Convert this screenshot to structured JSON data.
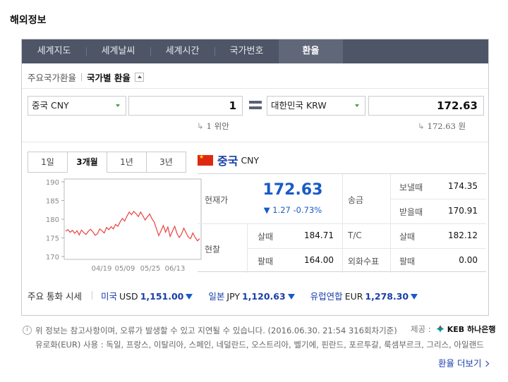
{
  "section_title": "해외정보",
  "tabs": [
    {
      "label": "세계지도"
    },
    {
      "label": "세계날씨"
    },
    {
      "label": "세계시간"
    },
    {
      "label": "국가번호"
    },
    {
      "label": "환율"
    }
  ],
  "subnav": {
    "item": "주요국가환율",
    "current": "국가별 환율"
  },
  "converter": {
    "from_currency": "중국 CNY",
    "from_amount": "1",
    "from_hint": "1 위안",
    "to_currency": "대한민국 KRW",
    "to_amount": "172.63",
    "to_hint": "172.63 원",
    "hint_arrow": "↳"
  },
  "period_tabs": [
    "1일",
    "3개월",
    "1년",
    "3년"
  ],
  "currency": {
    "name": "중국",
    "code": "CNY"
  },
  "rates": {
    "current_label": "현재가",
    "current_value": "172.63",
    "change": "▼ 1.27 -0.73%",
    "cash_label": "현찰",
    "buy_label": "살때",
    "buy_value": "184.71",
    "sell_label": "팔때",
    "sell_value": "164.00",
    "remit_label": "송금",
    "send_label": "보낼때",
    "send_value": "174.35",
    "receive_label": "받을때",
    "receive_value": "170.91",
    "tc_label": "T/C",
    "tc_buy_label": "살때",
    "tc_buy_value": "182.12",
    "check_label": "외화수표",
    "check_sell_label": "팔때",
    "check_sell_value": "0.00"
  },
  "major": {
    "title": "주요 통화 시세",
    "items": [
      {
        "name": "미국",
        "code": "USD",
        "value": "1,151.00"
      },
      {
        "name": "일본",
        "code": "JPY",
        "value": "1,120.63"
      },
      {
        "name": "유럽연합",
        "code": "EUR",
        "value": "1,278.30"
      }
    ]
  },
  "note": {
    "line1": "위 정보는 참고사항이며, 오류가 발생할 수 있고 지연될 수 있습니다. (2016.06.30. 21:54 316회차기준)",
    "line2": "유로화(EUR) 사용 : 독일, 프랑스, 이탈리아, 스페인, 네덜란드, 오스트리아, 벨기에, 핀란드, 포르투갈, 룩셈부르크, 그리스, 아일랜드",
    "source_label": "제공 :",
    "source_name": "KEB 하나은행"
  },
  "more_link": "환율 더보기",
  "chart_data": {
    "type": "line",
    "x_ticks": [
      "04/19",
      "05/09",
      "05/25",
      "06/13"
    ],
    "yticks": [
      170,
      175,
      180,
      185,
      190
    ],
    "ylim": [
      170,
      190
    ],
    "color": "#e8423f",
    "values": [
      176.8,
      177.2,
      176.5,
      177.0,
      176.2,
      176.9,
      175.8,
      177.1,
      176.4,
      175.9,
      176.8,
      177.3,
      176.6,
      175.7,
      176.1,
      177.4,
      176.9,
      176.3,
      177.8,
      177.2,
      178.0,
      177.4,
      178.6,
      178.1,
      179.3,
      180.2,
      179.5,
      180.8,
      181.9,
      181.2,
      182.1,
      181.5,
      180.7,
      181.9,
      180.9,
      179.8,
      180.6,
      181.4,
      180.1,
      179.2,
      177.4,
      175.6,
      176.9,
      178.3,
      176.5,
      177.9,
      175.4,
      176.8,
      178.1,
      176.2,
      175.1,
      176.0,
      177.6,
      176.4,
      175.2,
      174.8,
      176.3,
      175.1,
      174.2,
      174.8
    ]
  }
}
